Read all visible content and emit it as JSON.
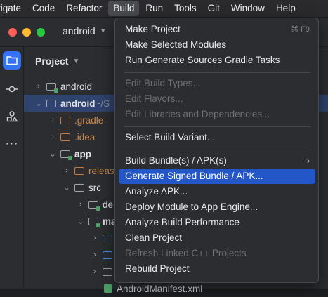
{
  "menubar": {
    "items": [
      "vigate",
      "Code",
      "Refactor",
      "Build",
      "Run",
      "Tools",
      "Git",
      "Window",
      "Help"
    ],
    "active": "Build"
  },
  "window": {
    "project_name": "android",
    "panel_title": "Project"
  },
  "tree": [
    {
      "label": "android",
      "suffix": "",
      "state": "collapsed"
    },
    {
      "label": "android",
      "suffix": " ~/S",
      "state": "expanded",
      "selected": true
    },
    {
      "label": ".gradle",
      "state": "collapsed"
    },
    {
      "label": ".idea",
      "state": "collapsed"
    },
    {
      "label": "app",
      "state": "expanded"
    },
    {
      "label": "releas",
      "state": "collapsed"
    },
    {
      "label": "src",
      "state": "expanded"
    },
    {
      "label": "de",
      "state": "collapsed"
    },
    {
      "label": "ma",
      "state": "expanded"
    },
    {
      "label": "",
      "state": "collapsed"
    },
    {
      "label": "",
      "state": "collapsed"
    },
    {
      "label": "",
      "state": "collapsed"
    },
    {
      "label": "AndroidManifest.xml",
      "state": "file"
    }
  ],
  "build_menu": {
    "items": [
      {
        "label": "Make Project",
        "shortcut": "⌘ F9"
      },
      {
        "label": "Make Selected Modules"
      },
      {
        "label": "Run Generate Sources Gradle Tasks"
      },
      {
        "label": "Edit Build Types...",
        "disabled": true
      },
      {
        "label": "Edit Flavors...",
        "disabled": true
      },
      {
        "label": "Edit Libraries and Dependencies...",
        "disabled": true
      },
      {
        "label": "Select Build Variant..."
      },
      {
        "label": "Build Bundle(s) / APK(s)",
        "submenu": "›"
      },
      {
        "label": "Generate Signed Bundle / APK...",
        "highlighted": true
      },
      {
        "label": "Analyze APK..."
      },
      {
        "label": "Deploy Module to App Engine..."
      },
      {
        "label": "Analyze Build Performance"
      },
      {
        "label": "Clean Project"
      },
      {
        "label": "Refresh Linked C++ Projects",
        "disabled": true
      },
      {
        "label": "Rebuild Project"
      }
    ]
  },
  "colors": {
    "highlight": "#2357c7",
    "selected_row": "#2e436e",
    "tool_active": "#3574f0"
  }
}
